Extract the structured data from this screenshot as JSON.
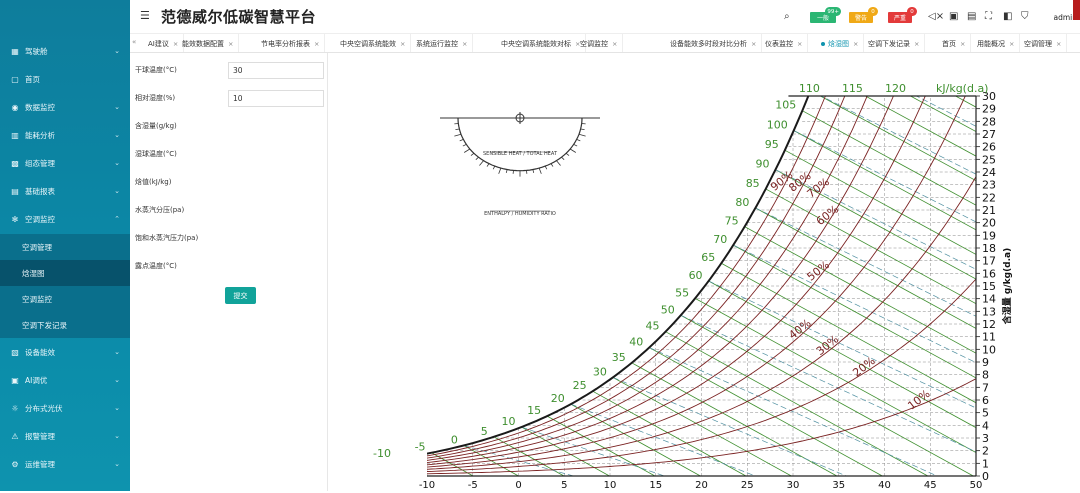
{
  "app": {
    "title": "范德威尔低碳智慧平台"
  },
  "sidebar": {
    "items": [
      {
        "label": "驾驶舱",
        "icon": "dashboard-icon",
        "expand": true
      },
      {
        "label": "首页",
        "icon": "home-icon",
        "expand": false
      },
      {
        "label": "数据监控",
        "icon": "monitor-icon",
        "expand": true
      },
      {
        "label": "能耗分析",
        "icon": "chart-icon",
        "expand": true
      },
      {
        "label": "组态管理",
        "icon": "grid-icon",
        "expand": true
      },
      {
        "label": "基础报表",
        "icon": "report-icon",
        "expand": true
      },
      {
        "label": "空调监控",
        "icon": "snowflake-icon",
        "expand": true
      },
      {
        "label": "设备能效",
        "icon": "device-icon",
        "expand": true
      },
      {
        "label": "AI调优",
        "icon": "ai-icon",
        "expand": true
      },
      {
        "label": "分布式光伏",
        "icon": "solar-icon",
        "expand": true
      },
      {
        "label": "报警管理",
        "icon": "alarm-icon",
        "expand": true
      },
      {
        "label": "运维管理",
        "icon": "maintenance-icon",
        "expand": true
      }
    ],
    "subitems": [
      {
        "label": "空调管理"
      },
      {
        "label": "焓湿图"
      },
      {
        "label": "空调监控"
      },
      {
        "label": "空调下发记录"
      }
    ]
  },
  "header": {
    "badges": [
      {
        "label": "一般",
        "count": "99+",
        "color": "#2bb673"
      },
      {
        "label": "警告",
        "count": "0",
        "color": "#f0a917"
      },
      {
        "label": "严重",
        "count": "0",
        "color": "#e33a3a"
      }
    ],
    "user": "admin"
  },
  "tabs": [
    {
      "label": "AI建议",
      "active": false
    },
    {
      "label": "能效数据配置",
      "active": false
    },
    {
      "label": "节电率分析报表",
      "active": false
    },
    {
      "label": "中央空调系统能效",
      "active": false
    },
    {
      "label": "系统运行监控",
      "active": false
    },
    {
      "label": "中央空调系统能效对标",
      "active": false
    },
    {
      "label": "空调监控",
      "active": false
    },
    {
      "label": "设备能效多时段对比分析",
      "active": false
    },
    {
      "label": "仪表监控",
      "active": false
    },
    {
      "label": "焓湿图",
      "active": true
    },
    {
      "label": "空调下发记录",
      "active": false
    },
    {
      "label": "首页",
      "active": false
    },
    {
      "label": "用能概况",
      "active": false
    },
    {
      "label": "空调管理",
      "active": false
    }
  ],
  "form": {
    "fields": [
      {
        "label": "干球温度(°C)",
        "value": "30",
        "input": true
      },
      {
        "label": "相对湿度(%)",
        "value": "10",
        "input": true
      },
      {
        "label": "含湿量(g/kg)",
        "value": "",
        "input": false
      },
      {
        "label": "湿球温度(°C)",
        "value": "",
        "input": false
      },
      {
        "label": "焓值(kJ/kg)",
        "value": "",
        "input": false
      },
      {
        "label": "水蒸汽分压(pa)",
        "value": "",
        "input": false
      },
      {
        "label": "饱和水蒸汽压力(pa)",
        "value": "",
        "input": false
      },
      {
        "label": "露点温度(°C)",
        "value": "",
        "input": false
      }
    ],
    "submit_label": "提交"
  },
  "chart_data": {
    "type": "line",
    "title": "",
    "xlabel": "",
    "ylabel": "含湿量 g/kg(d.a)",
    "enthalpy_unit": "kJ/kg(d.a)",
    "x_ticks": [
      -10,
      -5,
      0,
      5,
      10,
      15,
      20,
      25,
      30,
      35,
      40,
      45,
      50
    ],
    "y_ticks": [
      0,
      1,
      2,
      3,
      4,
      5,
      6,
      7,
      8,
      9,
      10,
      11,
      12,
      13,
      14,
      15,
      16,
      17,
      18,
      19,
      20,
      21,
      22,
      23,
      24,
      25,
      26,
      27,
      28,
      29,
      30
    ],
    "ylim": [
      0,
      30
    ],
    "xlim": [
      -10,
      50
    ],
    "enthalpy_ticks": [
      -10,
      -5,
      0,
      5,
      10,
      15,
      20,
      25,
      30,
      35,
      40,
      45,
      50,
      55,
      60,
      65,
      70,
      75,
      80,
      85,
      90,
      95,
      100,
      105,
      110,
      115,
      120
    ],
    "relative_humidity": [
      10,
      20,
      30,
      40,
      50,
      60,
      70,
      80,
      90
    ],
    "rh_labels": [
      "10%",
      "20%",
      "30%",
      "40%",
      "50%",
      "60%",
      "70%",
      "80%",
      "90%"
    ],
    "protractor": {
      "top_label": "SENSIBLE HEAT / TOTAL HEAT",
      "bottom_label": "ENTHALPY / HUMIDITY RATIO"
    },
    "colors": {
      "saturation": "#1a1a1a",
      "enthalpy": "#3f8f2f",
      "rh": "#7a2222",
      "wetbulb": "#4f8fa0",
      "grid": "#888888"
    }
  }
}
